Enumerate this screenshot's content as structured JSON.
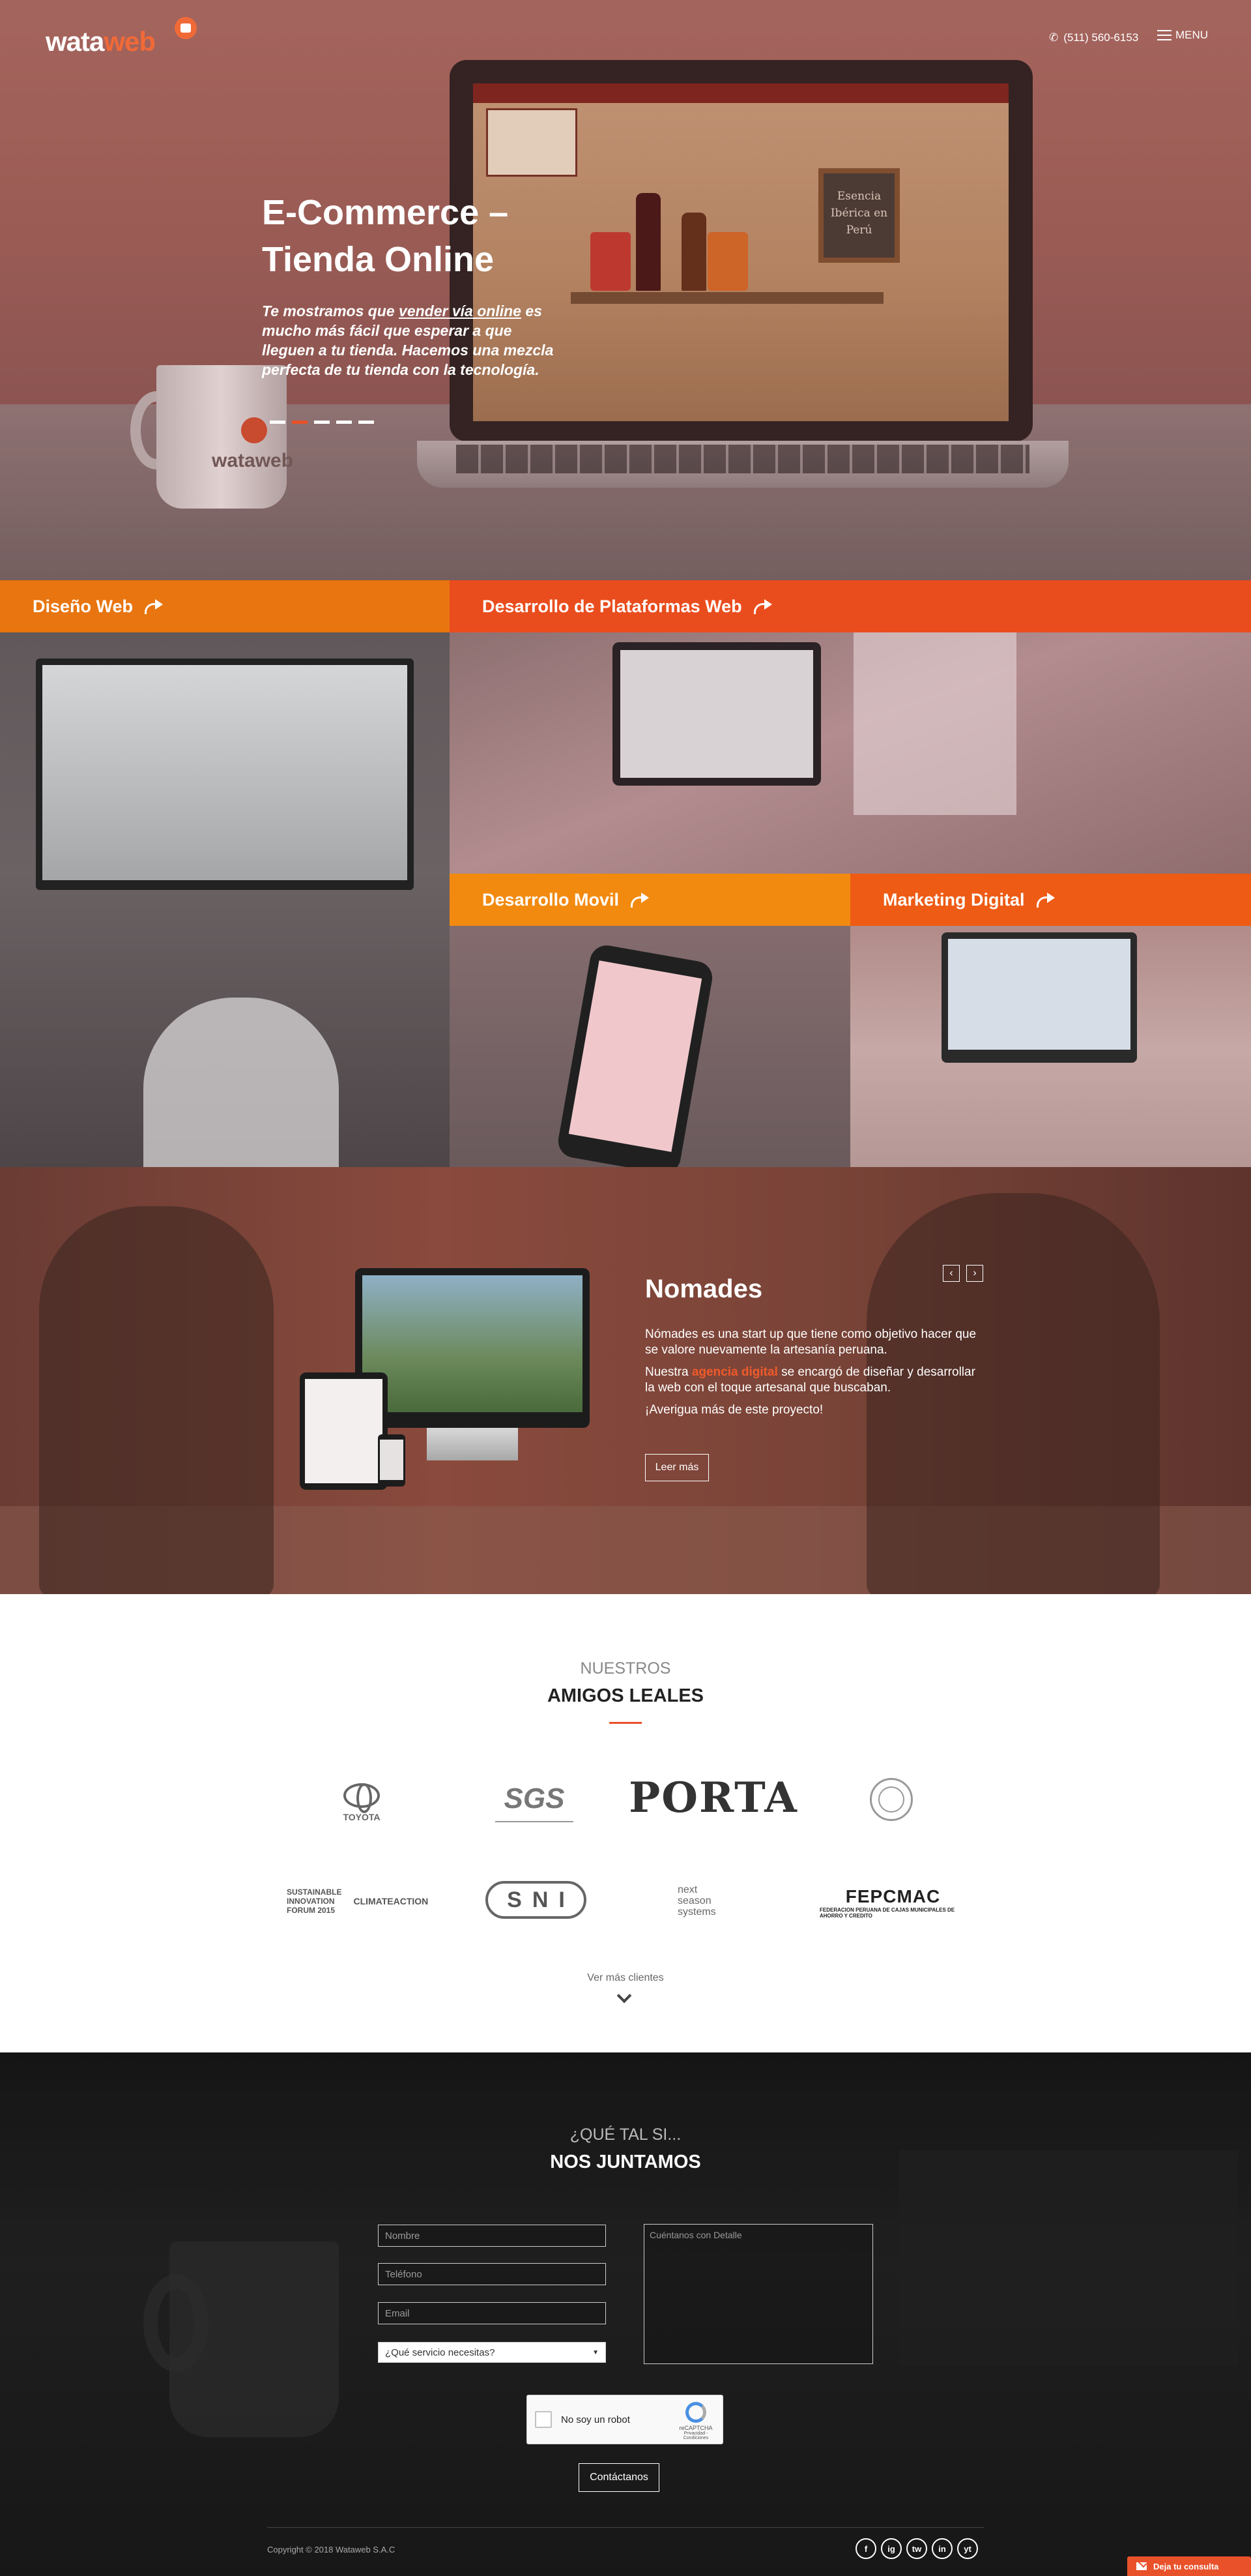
{
  "header": {
    "logo_wata": "wata",
    "logo_web": "web",
    "phone": "(511) 560-6153",
    "menu_label": "MENU"
  },
  "hero": {
    "title": "E-Commerce – Tienda Online",
    "subtitle_pre": "Te mostramos que ",
    "subtitle_link": "vender vía online",
    "subtitle_post": " es mucho más fácil que esperar a que lleguen a tu tienda. Hacemos una mezcla perfecta de tu tienda con la tecnología.",
    "slides": 5,
    "active_slide": 2,
    "screen_chalkboard": "Esencia Ibérica en Perú",
    "mug_logo": "wataweb"
  },
  "services": [
    {
      "label": "Diseño Web",
      "color": "#e8750f"
    },
    {
      "label": "Desarrollo de Plataformas Web",
      "color": "#ea4d1d"
    },
    {
      "label": "Desarrollo Movil",
      "color": "#f28a10"
    },
    {
      "label": "Marketing Digital",
      "color": "#ee5b14"
    }
  ],
  "project": {
    "title": "Nomades",
    "p1": "Nómades es una start up que tiene como objetivo hacer que se valore nuevamente la artesanía peruana.",
    "p2_pre": "Nuestra ",
    "p2_highlight": "agencia digital",
    "p2_post": " se encargó de diseñar y desarrollar la web con el toque artesanal que buscaban.",
    "p3": "¡Averigua más de este proyecto!",
    "button": "Leer más",
    "prev": "‹",
    "next": "›"
  },
  "clients": {
    "eyebrow": "NUESTROS",
    "heading": "AMIGOS LEALES",
    "logos": {
      "toyota": "TOYOTA",
      "sgs": "SGS",
      "porta": "PORTA",
      "sif_line1": "SUSTAINABLE",
      "sif_line2": "INNOVATION",
      "sif_line3": "FORUM 2015",
      "sif_ca": "CLIMATEACTION",
      "sni": "SNI",
      "nss_1": "next",
      "nss_2": "season",
      "nss_3": "systems",
      "fep": "FEPCMAC",
      "fep_sub": "FEDERACION PERUANA DE CAJAS MUNICIPALES DE AHORRO Y CREDITO"
    },
    "more": "Ver más clientes"
  },
  "contact": {
    "eyebrow": "¿QUÉ TAL SI...",
    "heading": "NOS JUNTAMOS",
    "name_ph": "Nombre",
    "phone_ph": "Teléfono",
    "email_ph": "Email",
    "service_select": "¿Qué servicio necesitas?",
    "message_ph": "Cuéntanos con Detalle",
    "captcha_label": "No soy un robot",
    "captcha_brand": "reCAPTCHA",
    "captcha_terms": "Privacidad - Condiciones",
    "submit": "Contáctanos",
    "copyright": "Copyright © 2018 Wataweb S.A.C",
    "socials": [
      "f",
      "ig",
      "tw",
      "in",
      "yt"
    ],
    "chat_tab": "Deja tu consulta"
  }
}
